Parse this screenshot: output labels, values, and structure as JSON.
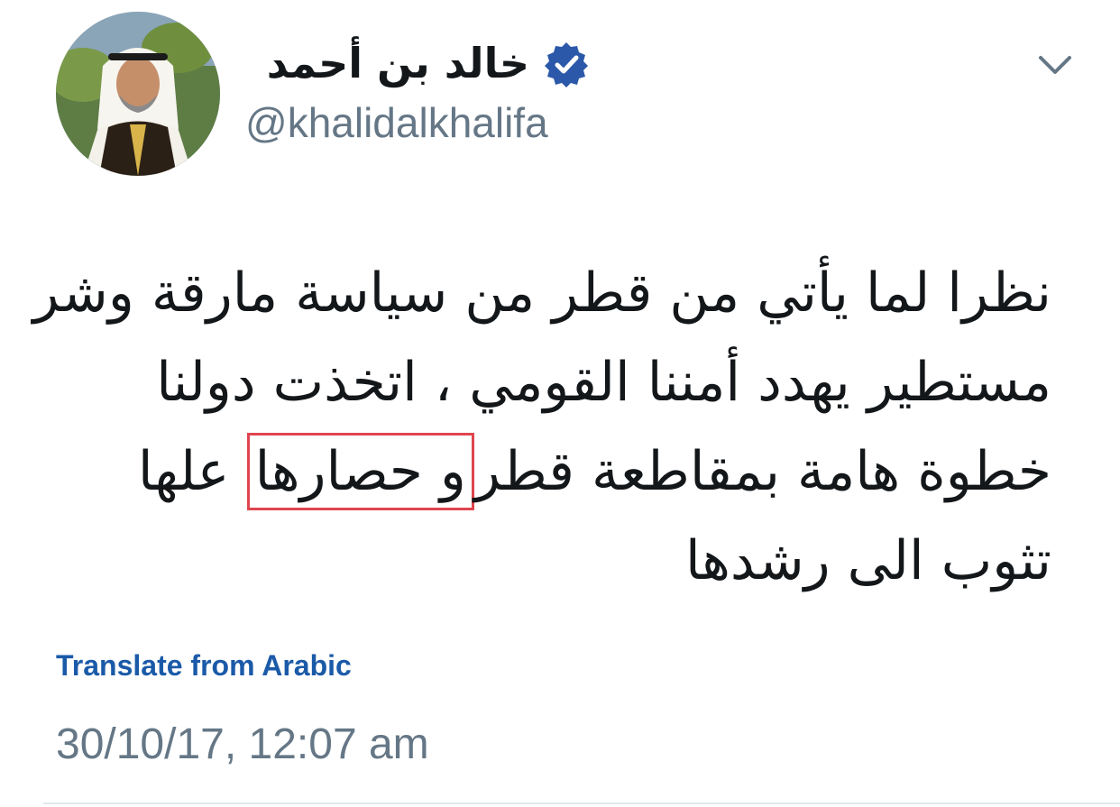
{
  "tweet": {
    "author": {
      "display_name": "خالد بن أحمد",
      "handle": "@khalidalkhalifa",
      "verified": true,
      "avatar_icon": "user-avatar-photo"
    },
    "menu_icon": "chevron-down-icon",
    "text_lines": [
      "نظرا لما يأتي من قطر  من سياسة مارقة وشر",
      "مستطير يهدد أمننا  القومي ، اتخذت دولنا"
    ],
    "line3": {
      "before": "خطوة هامة بمقاطعة قطر",
      "highlighted": "و حصارها",
      "after": "علها"
    },
    "line4": "تثوب الى رشدها",
    "translate_label": "Translate from Arabic",
    "timestamp": "30/10/17, 12:07 am"
  },
  "colors": {
    "highlight_border": "#e0454f",
    "link": "#1b5aa8",
    "verified": "#1d9bf0",
    "secondary_text": "#657786"
  }
}
